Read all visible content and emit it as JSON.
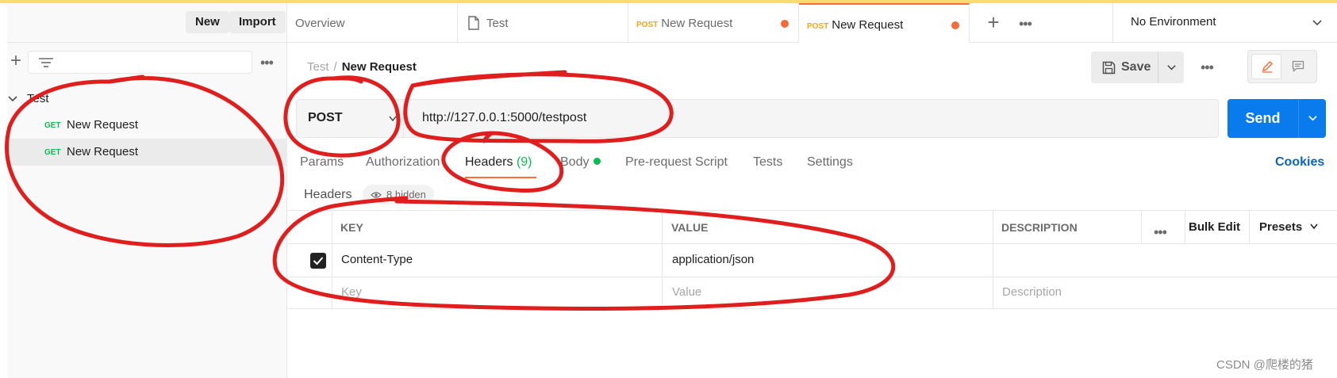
{
  "sidebar": {
    "new_label": "New",
    "import_label": "Import",
    "collection": "Test",
    "requests": [
      {
        "method": "GET",
        "name": "New Request"
      },
      {
        "method": "GET",
        "name": "New Request"
      }
    ]
  },
  "tabs": {
    "items": [
      {
        "label": "Overview"
      },
      {
        "label": "Test"
      },
      {
        "method": "POST",
        "label": "New Request"
      },
      {
        "method": "POST",
        "label": "New Request"
      }
    ],
    "environment": "No Environment"
  },
  "request": {
    "breadcrumb_parent": "Test",
    "breadcrumb_sep": "/",
    "breadcrumb_current": "New Request",
    "save_label": "Save",
    "method": "POST",
    "url": "http://127.0.0.1:5000/testpost",
    "send_label": "Send"
  },
  "request_tabs": {
    "params": "Params",
    "authorization": "Authorization",
    "headers": "Headers",
    "headers_count": "(9)",
    "body": "Body",
    "prerequest": "Pre-request Script",
    "tests": "Tests",
    "settings": "Settings",
    "cookies": "Cookies"
  },
  "headers_section": {
    "label": "Headers",
    "hidden": "8 hidden"
  },
  "table": {
    "col_key": "KEY",
    "col_value": "VALUE",
    "col_description": "DESCRIPTION",
    "bulk_edit": "Bulk Edit",
    "presets": "Presets",
    "rows": [
      {
        "key": "Content-Type",
        "value": "application/json",
        "checked": true
      }
    ],
    "placeholder_key": "Key",
    "placeholder_value": "Value",
    "placeholder_description": "Description"
  },
  "watermark": "CSDN @爬楼的猪",
  "colors": {
    "accent_orange": "#ff6c37",
    "send_blue": "#097bed",
    "get_green": "#0cbb52",
    "post_yellow": "#f2a81a",
    "annotation_red": "#e01e1e"
  }
}
